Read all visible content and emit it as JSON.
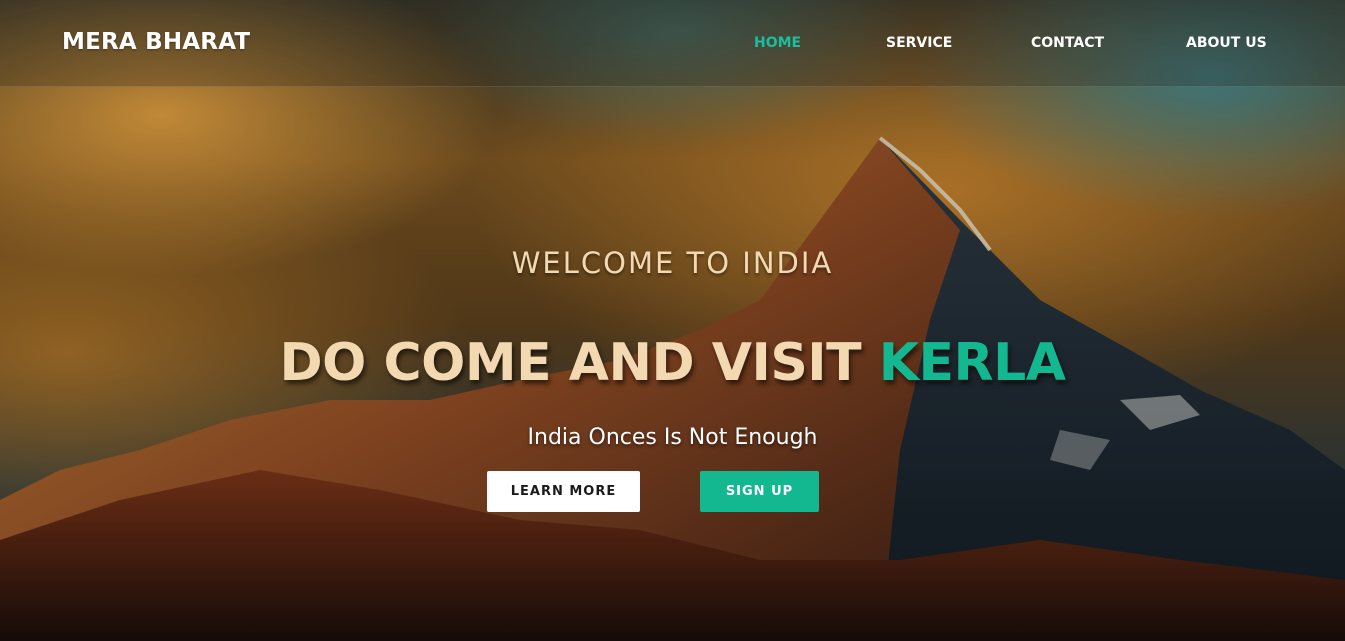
{
  "navbar": {
    "brand": "MERA BHARAT",
    "links": [
      {
        "label": "HOME",
        "active": true
      },
      {
        "label": "SERVICE",
        "active": false
      },
      {
        "label": "CONTACT",
        "active": false
      },
      {
        "label": "ABOUT US",
        "active": false
      }
    ]
  },
  "hero": {
    "welcome": "WELCOME TO INDIA",
    "headline_prefix": "DO COME AND VISIT",
    "headline_accent": "KERLA",
    "tagline": "India Onces Is Not Enough",
    "learn_more_label": "LEARN MORE",
    "sign_up_label": "SIGN UP",
    "background": "mountain-sunset-photo"
  },
  "colors": {
    "accent": "#14b890",
    "heading": "#f3d9b1",
    "nav_text": "#ffffff"
  }
}
